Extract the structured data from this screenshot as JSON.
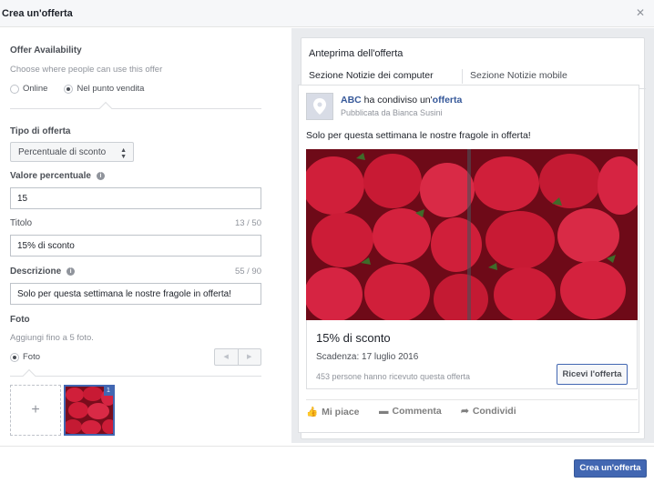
{
  "dialog": {
    "title": "Crea un'offerta",
    "close_icon": "close-icon"
  },
  "form": {
    "availability": {
      "label": "Offer Availability",
      "hint": "Choose where people can use this offer",
      "options": [
        {
          "label": "Online",
          "selected": false
        },
        {
          "label": "Nel punto vendita",
          "selected": true
        }
      ]
    },
    "offer_type": {
      "label": "Tipo di offerta",
      "value": "Percentuale di sconto"
    },
    "percent": {
      "label": "Valore percentuale",
      "value": "15"
    },
    "title_field": {
      "label": "Titolo",
      "counter": "13 / 50",
      "value": "15% di sconto"
    },
    "description": {
      "label": "Descrizione",
      "counter": "55 / 90",
      "value": "Solo per questa settimana le nostre fragole in offerta!"
    },
    "photo": {
      "label": "Foto",
      "hint": "Aggiungi fino a 5 foto.",
      "option": "Foto",
      "add_symbol": "+",
      "thumb_badge": "1"
    }
  },
  "preview": {
    "title": "Anteprima dell'offerta",
    "tabs": [
      "Sezione Notizie dei computer",
      "Sezione Notizie mobile"
    ],
    "post": {
      "page_name": "ABC",
      "action_text": "ha condiviso un'",
      "object": "offerta",
      "published_by": "Pubblicata da Bianca Susini",
      "text": "Solo per questa settimana le nostre fragole in offerta!",
      "offer_title": "15% di sconto",
      "expiry": "Scadenza: 17 luglio 2016",
      "claimed": "453 persone hanno ricevuto questa offerta",
      "claim_button": "Ricevi l'offerta",
      "actions": [
        "Mi piace",
        "Commenta",
        "Condividi"
      ]
    }
  },
  "footer": {
    "submit_label": "Crea un'offerta"
  },
  "colors": {
    "accent": "#4267b2",
    "link": "#365899",
    "panel_bg": "#e9ebee"
  }
}
